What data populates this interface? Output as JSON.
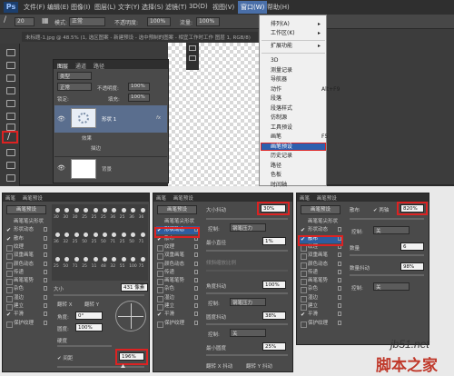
{
  "app": {
    "logo": "Ps",
    "menus": [
      "文件(F)",
      "编辑(E)",
      "图像(I)",
      "图层(L)",
      "文字(Y)",
      "选择(S)",
      "滤镜(T)",
      "3D(D)",
      "视图(V)",
      "窗口(W)",
      "帮助(H)"
    ],
    "active_menu": "窗口(W)"
  },
  "options_bar": {
    "brush_size": "20",
    "mode_label": "模式:",
    "mode_value": "正常",
    "opacity_label": "不透明度:",
    "opacity_value": "100%",
    "flow_label": "流量:",
    "flow_value": "100%"
  },
  "document_tab": "未标题-1.jpg @ 48.5% (1, 选区图案 - 新建预设 - 选中预制的图案 - 相宜工作时工作 图层 1, RGB/8)",
  "layers_panel": {
    "tabs": [
      "图层",
      "通道",
      "路径"
    ],
    "kind_label": "类型",
    "blend_mode": "正常",
    "opacity_label": "不透明度:",
    "opacity_value": "100%",
    "lock_label": "锁定:",
    "fill_label": "填充:",
    "fill_value": "100%",
    "layer_name": "形状 1",
    "fx": "fx",
    "effects_label": "效果",
    "effect_item": "描边",
    "background_layer": "背景"
  },
  "window_menu": {
    "items_top": [
      {
        "label": "排列(A)",
        "arrow": "▸"
      },
      {
        "label": "工作区(K)",
        "arrow": "▸"
      }
    ],
    "items_mid": [
      {
        "label": "扩展功能",
        "arrow": "▸"
      }
    ],
    "items_list": [
      {
        "label": "3D",
        "shortcut": ""
      },
      {
        "label": "测量记录",
        "shortcut": ""
      },
      {
        "label": "导航器",
        "shortcut": ""
      },
      {
        "label": "动作",
        "shortcut": "Alt+F9"
      },
      {
        "label": "段落",
        "shortcut": ""
      },
      {
        "label": "段落样式",
        "shortcut": ""
      },
      {
        "label": "仿制源",
        "shortcut": ""
      },
      {
        "label": "工具预设",
        "shortcut": ""
      },
      {
        "label": "画笔",
        "shortcut": "F5"
      },
      {
        "label": "画笔预设",
        "shortcut": ""
      },
      {
        "label": "历史记录",
        "shortcut": ""
      },
      {
        "label": "路径",
        "shortcut": ""
      },
      {
        "label": "色板",
        "shortcut": ""
      },
      {
        "label": "时间轴",
        "shortcut": ""
      }
    ],
    "highlighted": "画笔预设"
  },
  "brush_panels": [
    {
      "tabs": [
        "画笔",
        "画笔预设"
      ],
      "preset_button": "画笔预设",
      "list": [
        {
          "label": "画笔笔尖形状",
          "state": "none"
        },
        {
          "label": "形状动态",
          "state": "checked"
        },
        {
          "label": "散布",
          "state": "checked"
        },
        {
          "label": "纹理",
          "state": "box"
        },
        {
          "label": "双重画笔",
          "state": "box"
        },
        {
          "label": "颜色动态",
          "state": "box"
        },
        {
          "label": "传递",
          "state": "box"
        },
        {
          "label": "画笔笔势",
          "state": "box"
        },
        {
          "label": "杂色",
          "state": "box"
        },
        {
          "label": "湿边",
          "state": "box"
        },
        {
          "label": "建立",
          "state": "box"
        },
        {
          "label": "平滑",
          "state": "checked"
        },
        {
          "label": "保护纹理",
          "state": "box"
        }
      ],
      "brush_sizes": [
        "30",
        "30",
        "30",
        "25",
        "25",
        "25",
        "36",
        "25",
        "36",
        "36",
        "36",
        "32",
        "25",
        "50",
        "25",
        "50",
        "71",
        "25",
        "50",
        "71",
        "25",
        "50",
        "71",
        "25",
        "11",
        "48",
        "32",
        "55",
        "100",
        "75"
      ],
      "size_label": "大小",
      "size_value": "431 像素",
      "flip_x": "翻转 X",
      "flip_y": "翻转 Y",
      "angle_label": "角度:",
      "angle_value": "0°",
      "roundness_label": "圆度:",
      "roundness_value": "100%",
      "hardness_label": "硬度",
      "spacing_label": "间距",
      "spacing_value": "196%",
      "spacing_checked": true
    },
    {
      "tabs": [
        "画笔",
        "画笔预设"
      ],
      "preset_button": "画笔预设",
      "list": [
        {
          "label": "画笔笔尖形状",
          "state": "none"
        },
        {
          "label": "形状动态",
          "state": "checked-sel"
        },
        {
          "label": "散布",
          "state": "checked"
        },
        {
          "label": "纹理",
          "state": "box"
        },
        {
          "label": "双重画笔",
          "state": "box"
        },
        {
          "label": "颜色动态",
          "state": "box"
        },
        {
          "label": "传递",
          "state": "box"
        },
        {
          "label": "画笔笔势",
          "state": "box"
        },
        {
          "label": "杂色",
          "state": "box"
        },
        {
          "label": "湿边",
          "state": "box"
        },
        {
          "label": "建立",
          "state": "box"
        },
        {
          "label": "平滑",
          "state": "checked"
        },
        {
          "label": "保护纹理",
          "state": "box"
        }
      ],
      "size_jitter_label": "大小抖动",
      "size_jitter_value": "30%",
      "control_label": "控制:",
      "control_value": "钢笔压力",
      "min_diameter_label": "最小直径",
      "min_diameter_value": "1%",
      "tilt_scale_label": "倾斜缩放比例",
      "angle_jitter_label": "角度抖动",
      "angle_jitter_value": "100%",
      "control2_value": "钢笔压力",
      "roundness_jitter_label": "圆度抖动",
      "roundness_jitter_value": "38%",
      "control3_value": "关",
      "min_roundness_label": "最小圆度",
      "min_roundness_value": "25%",
      "flip_x_jitter": "翻转 X 抖动",
      "flip_y_jitter": "翻转 Y 抖动"
    },
    {
      "tabs": [
        "画笔",
        "画笔预设"
      ],
      "preset_button": "画笔预设",
      "list": [
        {
          "label": "画笔笔尖形状",
          "state": "none"
        },
        {
          "label": "形状动态",
          "state": "checked"
        },
        {
          "label": "散布",
          "state": "checked-sel"
        },
        {
          "label": "纹理",
          "state": "box"
        },
        {
          "label": "双重画笔",
          "state": "box"
        },
        {
          "label": "颜色动态",
          "state": "box"
        },
        {
          "label": "传递",
          "state": "box"
        },
        {
          "label": "画笔笔势",
          "state": "box"
        },
        {
          "label": "杂色",
          "state": "box"
        },
        {
          "label": "湿边",
          "state": "box"
        },
        {
          "label": "建立",
          "state": "box"
        },
        {
          "label": "平滑",
          "state": "checked"
        },
        {
          "label": "保护纹理",
          "state": "box"
        }
      ],
      "scatter_label": "散布",
      "both_axes_label": "两轴",
      "scatter_value": "820%",
      "control_label": "控制:",
      "control_value": "关",
      "count_label": "数量",
      "count_value": "6",
      "count_jitter_label": "数量抖动",
      "count_jitter_value": "98%",
      "control2_value": "关"
    }
  ],
  "watermark": {
    "site": "jb51.net",
    "brand": "脚本之家"
  }
}
